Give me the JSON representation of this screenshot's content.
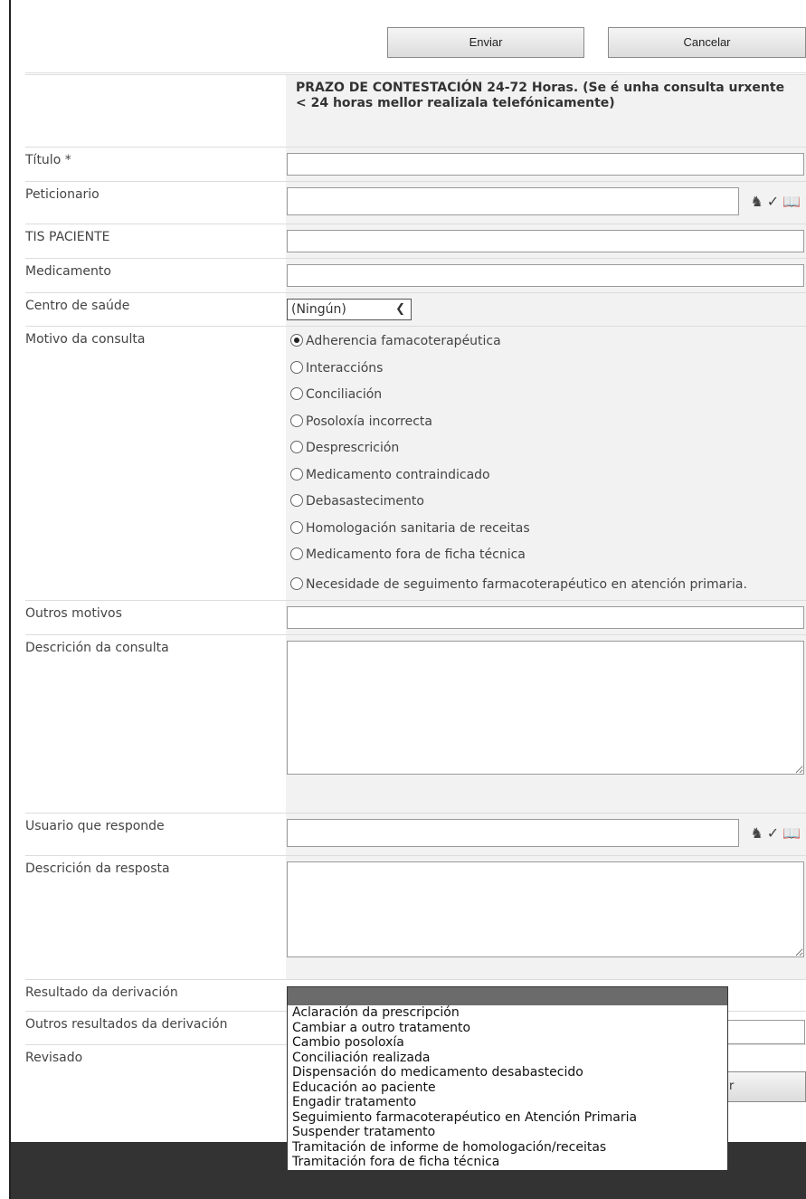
{
  "toolbar": {
    "submit_label": "Enviar",
    "cancel_label": "Cancelar"
  },
  "notice": "PRAZO DE CONTESTACIÓN 24-72 Horas. (Se é unha consulta urxente < 24 horas mellor realizala telefónicamente)",
  "fields": {
    "titulo": "Título *",
    "peticionario": "Peticionario",
    "tis": "TIS PACIENTE",
    "medicamento": "Medicamento",
    "centro": "Centro de saúde",
    "centro_value": "(Ningún)",
    "motivo": "Motivo da consulta",
    "outros_motivos": "Outros motivos",
    "descricion_consulta": "Descrición da consulta",
    "usuario_responde": "Usuario que responde",
    "descricion_resposta": "Descrición da resposta",
    "resultado": "Resultado da derivación",
    "outros_resultados": "Outros resultados da derivación",
    "revisado": "Revisado"
  },
  "motivo_options": [
    {
      "label": "Adherencia famacoterapéutica",
      "selected": true
    },
    {
      "label": "Interaccións",
      "selected": false
    },
    {
      "label": "Conciliación",
      "selected": false
    },
    {
      "label": "Posoloxía incorrecta",
      "selected": false
    },
    {
      "label": "Desprescrición",
      "selected": false
    },
    {
      "label": "Medicamento contraindicado",
      "selected": false
    },
    {
      "label": "Debasastecimento",
      "selected": false
    },
    {
      "label": "Homologación sanitaria de receitas",
      "selected": false
    },
    {
      "label": "Medicamento fora de ficha técnica",
      "selected": false
    },
    {
      "label": "Necesidade de seguimento farmacoterapéutico en atención primaria.",
      "selected": false
    }
  ],
  "resultado_options": [
    "Aclaración da prescripción",
    "Cambiar a outro tratamento",
    "Cambio posoloxía",
    "Conciliación realizada",
    "Dispensación do medicamento desabastecido",
    "Educación ao paciente",
    "Engadir tratamento",
    "Seguimiento farmacoterapéutico en Atención Primaria",
    "Suspender tratamento",
    "Tramitación de informe de homologación/receitas",
    "Tramitación fora de ficha técnica"
  ],
  "partial_button_label": "r",
  "icons": {
    "people_picker": "person-check-icon",
    "address_book": "address-book-icon"
  }
}
